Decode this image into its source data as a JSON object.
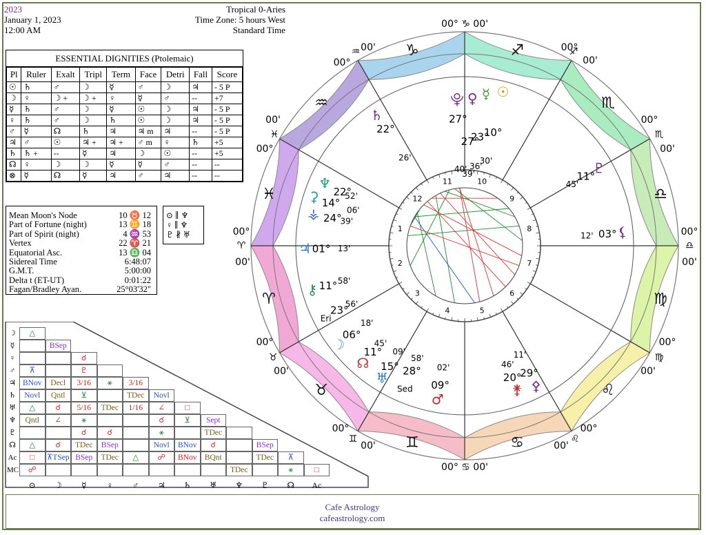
{
  "header": {
    "year": "2023",
    "date": "January 1, 2023",
    "time": "12:00 AM",
    "zodiac": "Tropical 0-Aries",
    "timezone": "Time Zone: 5 hours West",
    "standard": "Standard Time"
  },
  "dignities": {
    "title": "ESSENTIAL DIGNITIES  (Ptolemaic)",
    "columns": [
      "Pl",
      "Ruler",
      "Exalt",
      "Tripl",
      "Term",
      "Face",
      "Detri",
      "Fall",
      "Score"
    ],
    "rows": [
      [
        "☉",
        "♄",
        "♂",
        "☽",
        "☿",
        "♂",
        "☽",
        "♃",
        "- 5 P"
      ],
      [
        "☽",
        "♀",
        "☽ +",
        "☽ +",
        "♀",
        "☿",
        "♂",
        "--",
        "+7"
      ],
      [
        "☿",
        "♄",
        "♂",
        "☽",
        "☿",
        "☉",
        "☽",
        "♃",
        "- 5 P"
      ],
      [
        "♀",
        "♄",
        "♂",
        "☽",
        "♄",
        "☉",
        "☽",
        "♃",
        "- 5 P"
      ],
      [
        "♂",
        "☿",
        "☊",
        "♄",
        "♃",
        "♃  m",
        "♃",
        "--",
        "- 5 P"
      ],
      [
        "♃",
        "♂",
        "☉",
        "♃ +",
        "♃ +",
        "♂  m",
        "♀",
        "♄",
        "+5"
      ],
      [
        "♄",
        "♄ +",
        "--",
        "☿",
        "♃",
        "☽",
        "☉",
        "--",
        "+5"
      ],
      [
        "☊",
        "♀",
        "☽",
        "☽",
        "☿",
        "☿",
        "♂",
        "--",
        "--"
      ],
      [
        "⊗",
        "☿",
        "☊",
        "☿",
        "♃",
        "♂",
        "♃",
        "--",
        "--"
      ]
    ]
  },
  "points": [
    {
      "label": "Mean Moon's Node",
      "value": "10 ♉ 12"
    },
    {
      "label": "Part of Fortune (night)",
      "value": "13 ♊ 18"
    },
    {
      "label": "Part of Spirit (night)",
      "value": "4 ♒ 53"
    },
    {
      "label": "Vertex",
      "value": "22 ♈ 21"
    },
    {
      "label": "Equatorial Asc.",
      "value": "13 ♎ 04"
    },
    {
      "label": "Sidereal Time",
      "value": "6:48:07"
    },
    {
      "label": "G.M.T.",
      "value": "5:00:00"
    },
    {
      "label": "Delta t (ET-UT)",
      "value": "0:01:22"
    },
    {
      "label": "Fagan/Bradley Ayan.",
      "value": "25°03'32\""
    }
  ],
  "parallels": [
    "⊙ ∥ ♆",
    "♀ ∥ ♆",
    "♇ ∦ ♅"
  ],
  "aspects": {
    "rows": [
      {
        "p": "☽",
        "cells": [
          [
            "△",
            "grn"
          ]
        ]
      },
      {
        "p": "☿",
        "cells": [
          [
            "",
            ""
          ],
          [
            "BSep",
            "pur"
          ]
        ]
      },
      {
        "p": "♀",
        "cells": [
          [
            "",
            ""
          ],
          [
            "",
            ""
          ],
          [
            "☌",
            "red"
          ]
        ]
      },
      {
        "p": "♂",
        "cells": [
          [
            "⊼",
            "blu"
          ],
          [
            "",
            ""
          ],
          [
            "♇",
            "red"
          ],
          [
            "",
            ""
          ]
        ]
      },
      {
        "p": "♃",
        "cells": [
          [
            "BNov",
            "blu"
          ],
          [
            "Decl",
            "brn"
          ],
          [
            "3/16",
            "red"
          ],
          [
            "⚹",
            "grn"
          ],
          [
            "3/16",
            "red"
          ]
        ]
      },
      {
        "p": "♄",
        "cells": [
          [
            "Novl",
            "blu"
          ],
          [
            "Qntl",
            "brn"
          ],
          [
            "⊻",
            "grn"
          ],
          [
            "",
            ""
          ],
          [
            "TDec",
            "brn"
          ],
          [
            "Novl",
            "blu"
          ]
        ]
      },
      {
        "p": "♅",
        "cells": [
          [
            "△",
            "grn"
          ],
          [
            "☌",
            "red"
          ],
          [
            "5/16",
            "red"
          ],
          [
            "TDec",
            "brn"
          ],
          [
            "1/16",
            "red"
          ],
          [
            "∠",
            "red"
          ],
          [
            "□",
            "red"
          ]
        ]
      },
      {
        "p": "♆",
        "cells": [
          [
            "Qntl",
            "brn"
          ],
          [
            "∠",
            "red"
          ],
          [
            "⚹",
            "grn"
          ],
          [
            "",
            ""
          ],
          [
            "",
            ""
          ],
          [
            "☌",
            "red"
          ],
          [
            "⊻",
            "grn"
          ],
          [
            "Sept",
            "pur"
          ]
        ]
      },
      {
        "p": "♇",
        "cells": [
          [
            "",
            ""
          ],
          [
            "",
            ""
          ],
          [
            "☌",
            "red"
          ],
          [
            "☌",
            "red"
          ],
          [
            "",
            ""
          ],
          [
            "⚹",
            "grn"
          ],
          [
            "",
            ""
          ],
          [
            "TDec",
            "brn"
          ],
          [
            "",
            ""
          ]
        ]
      },
      {
        "p": "☊",
        "cells": [
          [
            "△",
            "grn"
          ],
          [
            "☌",
            "red"
          ],
          [
            "TDec",
            "brn"
          ],
          [
            "BSep",
            "pur"
          ],
          [
            "",
            ""
          ],
          [
            "Novl",
            "blu"
          ],
          [
            "BNov",
            "blu"
          ],
          [
            "☌",
            "red"
          ],
          [
            "",
            ""
          ],
          [
            "BSep",
            "pur"
          ]
        ]
      },
      {
        "p": "Ac",
        "cells": [
          [
            "□",
            "red"
          ],
          [
            "⊼TSep",
            "blu"
          ],
          [
            "BSep",
            "pur"
          ],
          [
            "TDec",
            "brn"
          ],
          [
            "△",
            "grn"
          ],
          [
            "☍",
            "red"
          ],
          [
            "BNov",
            "red"
          ],
          [
            "BQnt",
            "brn"
          ],
          [
            "",
            ""
          ],
          [
            "TDec",
            "brn"
          ],
          [
            "⊼",
            "blu"
          ]
        ]
      },
      {
        "p": "MC",
        "cells": [
          [
            "☍",
            "red"
          ],
          [
            "",
            ""
          ],
          [
            "",
            ""
          ],
          [
            "",
            ""
          ],
          [
            "",
            ""
          ],
          [
            "",
            ""
          ],
          [
            "",
            ""
          ],
          [
            "",
            ""
          ],
          [
            "TDec",
            "brn"
          ],
          [
            "",
            ""
          ],
          [
            "⚹",
            "grn"
          ],
          [
            "□",
            "red"
          ]
        ]
      }
    ],
    "footer": [
      "⊙",
      "☽",
      "☿",
      "♀",
      "♂",
      "♃",
      "♄",
      "♅",
      "♆",
      "♇",
      "☊",
      "Ac"
    ]
  },
  "wheel": {
    "cusp_labels": {
      "mc": "00° ♑ 00'",
      "ic": "00° ♋ 00'",
      "asc_left": "00°",
      "asc_sign": "♈",
      "asc_min": "00'",
      "desc_left": "00°",
      "desc_sign": "♎",
      "desc_min": "00'",
      "c11_deg": "00°",
      "c11_sign": "♒",
      "c11_min": "00'",
      "c12_deg": "00°",
      "c12_sign": "♓",
      "c12_min": "00'",
      "c2_deg": "00°",
      "c2_sign": "♉",
      "c2_min": "00'",
      "c3_deg": "00°",
      "c3_sign": "♊",
      "c3_min": "00'",
      "c9_deg": "00°",
      "c9_sign": "♐",
      "c9_min": "00'",
      "c8_deg": "00°",
      "c8_sign": "♏",
      "c8_min": "00'",
      "c6_deg": "00°",
      "c6_sign": "♍",
      "c6_min": "00'",
      "c5_deg": "00°",
      "c5_sign": "♌",
      "c5_min": "00'"
    },
    "signs": [
      "♑",
      "♐",
      "♏",
      "♎",
      "♍",
      "♌",
      "♋",
      "♊",
      "♉",
      "♈",
      "♓",
      "♒"
    ],
    "house_numbers": [
      "10",
      "9",
      "8",
      "7",
      "6",
      "5",
      "4",
      "3",
      "2",
      "1",
      "12",
      "11"
    ],
    "planet_labels": [
      {
        "g": "☉",
        "t": "10°",
        "t2": "30'",
        "c": "#c8a000"
      },
      {
        "g": "☿",
        "t": "23°",
        "t2": "36'",
        "c": "#4a9a3a"
      },
      {
        "g": "♀",
        "t": "27°",
        "t2": "39'",
        "c": "#7a2a8a"
      },
      {
        "g": "⯓",
        "t": "27°",
        "t2": "40'",
        "c": "#7a2a8a"
      },
      {
        "g": "♄",
        "t": "22°",
        "t2": "26'",
        "c": "#7a2a8a"
      },
      {
        "g": "♆",
        "t": "22°",
        "t2": "52'",
        "c": "#1a9a7a"
      },
      {
        "g": "⚳",
        "t": "14°",
        "t2": "06'",
        "c": "#1a9ab0"
      },
      {
        "g": "⚶",
        "t": "24°",
        "t2": "39'",
        "c": "#4a66c0"
      },
      {
        "g": "♃",
        "t": "01°",
        "t2": "13'",
        "c": "#2a7ad0"
      },
      {
        "g": "⚷",
        "t": "11°",
        "t2": "58'",
        "c": "#2a8a4a"
      },
      {
        "g": "Eri",
        "t": "23°",
        "t2": "56'",
        "c": "#000"
      },
      {
        "g": "☽",
        "t": "06°",
        "t2": "18'",
        "c": "#4a9ad0"
      },
      {
        "g": "☊",
        "t": "11°",
        "t2": "45'",
        "c": "#c03030"
      },
      {
        "g": "♅",
        "t": "15°",
        "t2": "09'",
        "c": "#2a7ad0"
      },
      {
        "g": "Sed",
        "t": "28°",
        "t2": "58'",
        "c": "#000"
      },
      {
        "g": "♂",
        "t": "09°",
        "t2": "02'",
        "c": "#d02020"
      },
      {
        "g": "⚵",
        "t": "20°",
        "t2": "46'",
        "c": "#c03030"
      },
      {
        "g": "⚴",
        "t": "29°",
        "t2": "11'",
        "c": "#7a2a8a"
      },
      {
        "g": "⚸",
        "t": "03°",
        "t2": "12'",
        "c": "#7a2a8a"
      },
      {
        "g": "♇",
        "t": "11°",
        "t2": "45'",
        "c": "#7a2a8a"
      }
    ]
  },
  "footer": {
    "line1": "Cafe Astrology",
    "line2": "cafeastrology.com"
  },
  "colors": {
    "frame": "#6b7a4d",
    "capricorn": "#a8d4ee",
    "aquarius": "#b9a8e0",
    "pisces": "#cfa8ee",
    "aries": "#f2a8d4",
    "taurus": "#f6b8e6",
    "gemini": "#f6bcc8",
    "cancer": "#f6d8b8",
    "leo": "#f6f0a8",
    "virgo": "#dcf4a8",
    "libra": "#c8ecb8",
    "scorpio": "#a8ecc0",
    "sagittarius": "#a8ecd4"
  }
}
